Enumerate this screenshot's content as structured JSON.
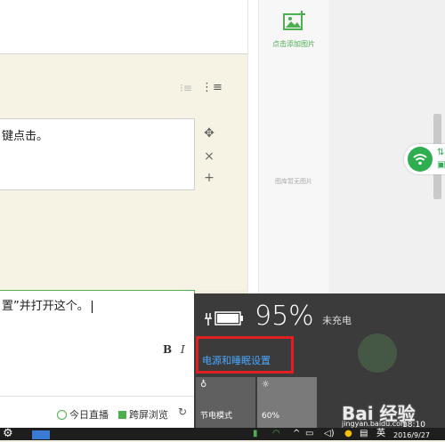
{
  "editor": {
    "block1_text": "键点击。",
    "block2_text": "置”并打开这个。",
    "bold_label": "B",
    "italic_label": "I"
  },
  "toolbar_bottom": {
    "live_label": "今日直播",
    "preview_label": "跨屏浏览"
  },
  "gallery": {
    "add_label": "点击添加图片",
    "empty_label": "图库暂无图片"
  },
  "battery": {
    "percent": "95%",
    "status": "未充电",
    "settings_link": "电源和睡眠设置",
    "saver_label": "节电模式",
    "brightness_label": "60%"
  },
  "taskbar": {
    "ime": "英",
    "time": "18:10",
    "date": "2016/9/27"
  },
  "watermark": {
    "brand": "Bai 经验",
    "url": "jingyan.baidu.com"
  },
  "colors": {
    "accent_green": "#4caf50",
    "highlight_red": "#e02020",
    "link_blue": "#4aa8ff",
    "flyout_bg": "#3b3b3b"
  }
}
